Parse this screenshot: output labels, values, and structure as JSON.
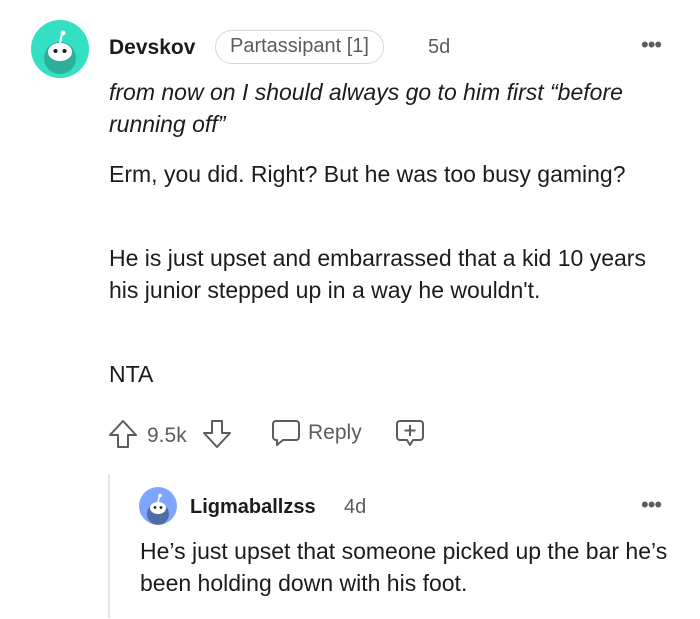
{
  "comment": {
    "author": "Devskov",
    "flair": "Partassipant [1]",
    "age": "5d",
    "more_label": "•••",
    "quote": "from now on I should always go to him first “before running off”",
    "paragraphs": [
      "Erm, you did. Right? But he was too busy gaming?",
      "He is just upset and embarrassed that a kid 10 years his junior stepped up in a way he wouldn't.",
      "NTA"
    ],
    "score": "9.5k",
    "reply_label": "Reply",
    "avatar_color": "#34e0c4"
  },
  "reply": {
    "author": "Ligmaballzss",
    "age": "4d",
    "more_label": "•••",
    "text": "He’s just upset that someone picked up the bar he’s been holding down with his foot.",
    "avatar_color": "#7fa6ff"
  },
  "colors": {
    "text": "#1c1c1c",
    "muted": "#5c5c5c",
    "thread_line": "#e4e4e4"
  }
}
